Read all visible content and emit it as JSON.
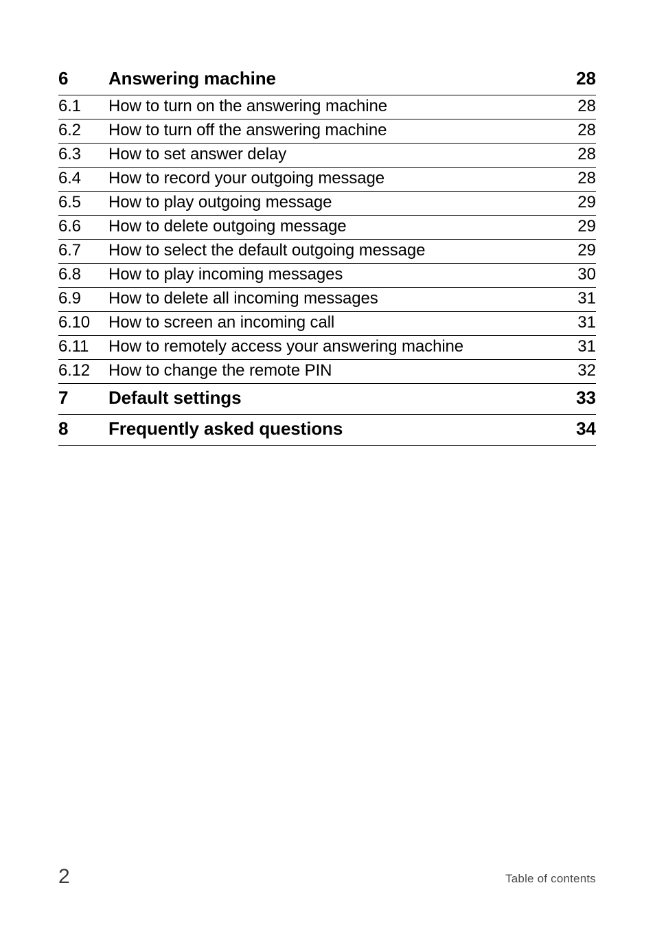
{
  "document": {
    "type": "table-of-contents",
    "page_background": "#ffffff",
    "text_color": "#000000"
  },
  "toc": {
    "entries": [
      {
        "number": "6",
        "title": "Answering machine",
        "page": "28",
        "level": 1
      },
      {
        "number": "6.1",
        "title": "How to turn on the answering machine",
        "page": "28",
        "level": 2
      },
      {
        "number": "6.2",
        "title": "How to turn off the answering machine",
        "page": "28",
        "level": 2
      },
      {
        "number": "6.3",
        "title": "How to set answer delay",
        "page": "28",
        "level": 2
      },
      {
        "number": "6.4",
        "title": "How to record your outgoing message",
        "page": "28",
        "level": 2
      },
      {
        "number": "6.5",
        "title": "How to play outgoing message",
        "page": "29",
        "level": 2
      },
      {
        "number": "6.6",
        "title": "How to delete outgoing message",
        "page": "29",
        "level": 2
      },
      {
        "number": "6.7",
        "title": "How to select the default outgoing message",
        "page": "29",
        "level": 2
      },
      {
        "number": "6.8",
        "title": "How to play incoming messages",
        "page": "30",
        "level": 2
      },
      {
        "number": "6.9",
        "title": "How to delete all incoming messages",
        "page": "31",
        "level": 2
      },
      {
        "number": "6.10",
        "title": "How to screen an incoming call",
        "page": "31",
        "level": 2
      },
      {
        "number": "6.11",
        "title": "How to remotely access your answering machine",
        "page": "31",
        "level": 2
      },
      {
        "number": "6.12",
        "title": "How to change the remote PIN",
        "page": "32",
        "level": 2
      },
      {
        "number": "7",
        "title": "Default settings",
        "page": "33",
        "level": 1
      },
      {
        "number": "8",
        "title": "Frequently asked questions",
        "page": "34",
        "level": 1
      }
    ]
  },
  "footer": {
    "page_number": "2",
    "section_label": "Table of contents"
  }
}
